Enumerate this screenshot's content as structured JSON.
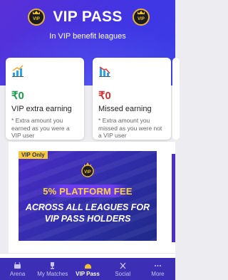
{
  "header": {
    "title": "VIP PASS",
    "subtitle": "In VIP benefit leagues",
    "badge_text": "VIP",
    "gradient_colors": [
      "#5a2fd6",
      "#3a3fe6"
    ]
  },
  "cards": [
    {
      "icon": "bar-chart-up-icon",
      "amount": "₹0",
      "title": "VIP extra earning",
      "note": "* Extra amount you earned as you were a VIP user",
      "amount_color": "#1e9a4e"
    },
    {
      "icon": "bar-chart-down-icon",
      "amount": "₹0",
      "title": "Missed earning",
      "note": "* Extra amount you missed as you were not a VIP user",
      "amount_color": "#d32f2f"
    }
  ],
  "promo": {
    "tag": "VIP Only",
    "headline": "5% PLATFORM FEE",
    "line1": "ACROSS ALL LEAGUES FOR",
    "line2": "VIP PASS HOLDERS",
    "headline_color": "#ffd23c"
  },
  "bottom_nav": {
    "items": [
      {
        "label": "Arena",
        "icon": "arena-icon",
        "active": false
      },
      {
        "label": "My Matches",
        "icon": "trophy-icon",
        "active": false
      },
      {
        "label": "VIP Pass",
        "icon": "vip-helmet-icon",
        "active": true
      },
      {
        "label": "Social",
        "icon": "social-icon",
        "active": false
      },
      {
        "label": "More",
        "icon": "more-icon",
        "active": false
      }
    ],
    "background": "#3c2fb5"
  }
}
